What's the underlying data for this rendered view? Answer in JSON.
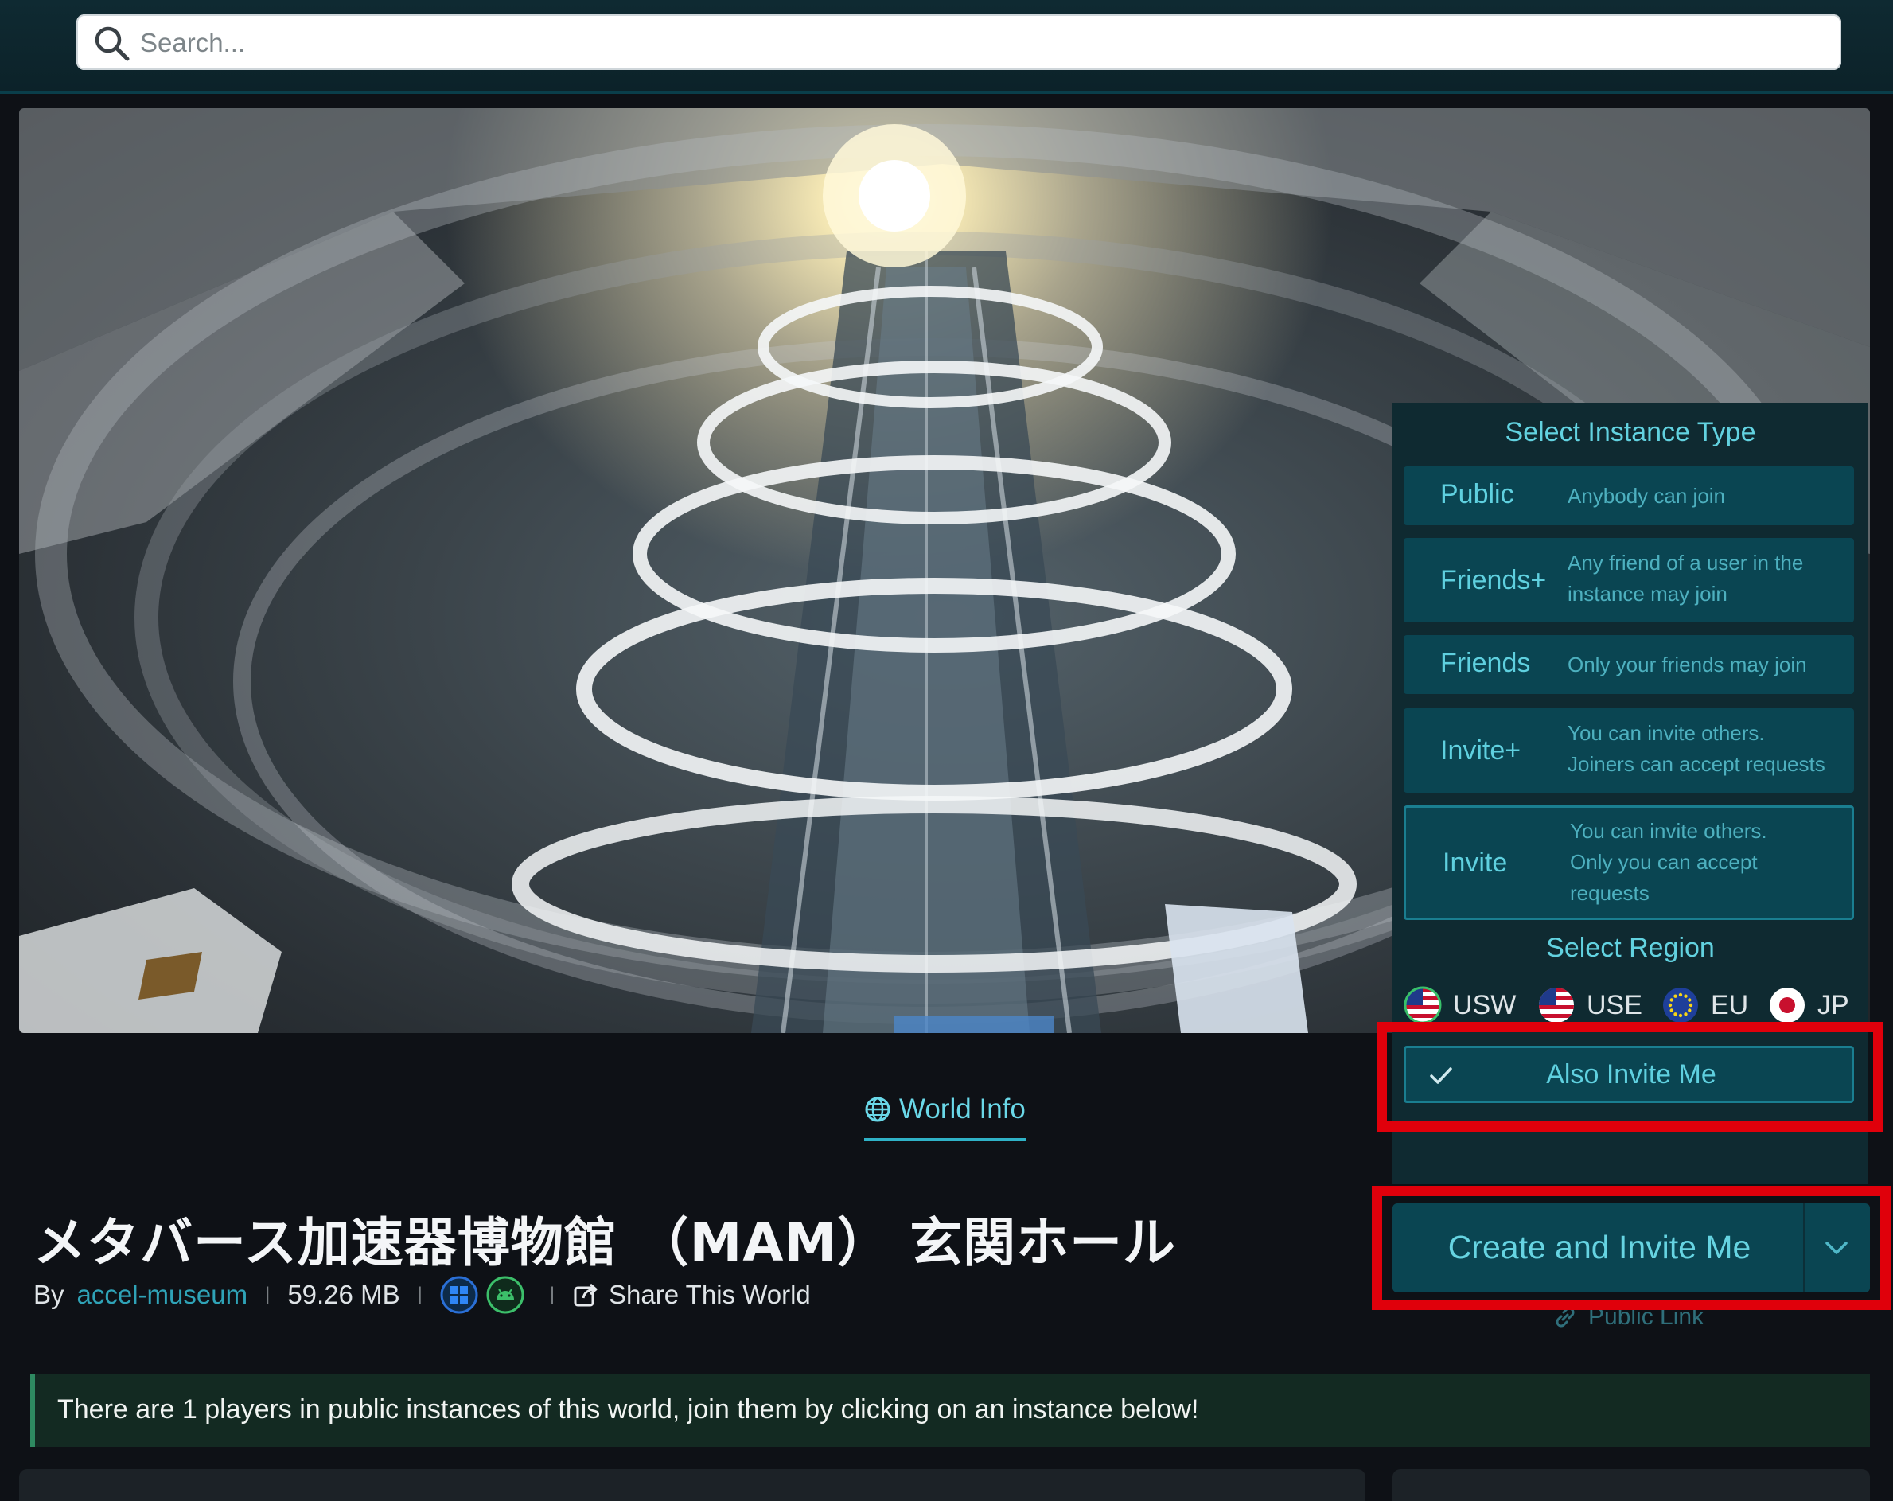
{
  "search": {
    "placeholder": "Search..."
  },
  "instance_panel": {
    "title": "Select Instance Type",
    "types": [
      {
        "name": "Public",
        "desc_lines": [
          "Anybody can join"
        ],
        "selected": false
      },
      {
        "name": "Friends+",
        "desc_lines": [
          "Any friend of a user in the",
          "instance may join"
        ],
        "selected": false
      },
      {
        "name": "Friends",
        "desc_lines": [
          "Only your friends may join"
        ],
        "selected": false
      },
      {
        "name": "Invite+",
        "desc_lines": [
          "You can invite others.",
          "Joiners can accept requests"
        ],
        "selected": false
      },
      {
        "name": "Invite",
        "desc_lines": [
          "You can invite others.",
          "Only you can accept",
          "requests"
        ],
        "selected": true
      }
    ],
    "region_title": "Select Region",
    "regions": [
      {
        "code": "USW",
        "icon": "us-flag-icon"
      },
      {
        "code": "USE",
        "icon": "us-flag-icon"
      },
      {
        "code": "EU",
        "icon": "eu-flag-icon"
      },
      {
        "code": "JP",
        "icon": "jp-flag-icon"
      }
    ],
    "also_invite_label": "Also Invite Me",
    "also_invite_checked": true
  },
  "create_button": {
    "label": "Create and Invite Me",
    "dropdown_icon": "chevron-down-icon"
  },
  "public_link": "Public Link",
  "tab": {
    "label": "World Info",
    "icon": "globe-icon"
  },
  "world": {
    "title": "メタバース加速器博物館 （MAM） 玄関ホール",
    "by_label": "By",
    "author": "accel-museum",
    "size": "59.26 MB",
    "platforms": [
      "windows-icon",
      "android-icon"
    ],
    "share_label": "Share This World"
  },
  "notice": "There are 1 players in public instances of this world, join them by clicking on an instance below!",
  "colors": {
    "accent": "#5fd0df",
    "panel_bg": "#0f2a31",
    "option_bg": "#0a4552",
    "highlight": "#e0000b",
    "notice_bg": "#132a22"
  }
}
